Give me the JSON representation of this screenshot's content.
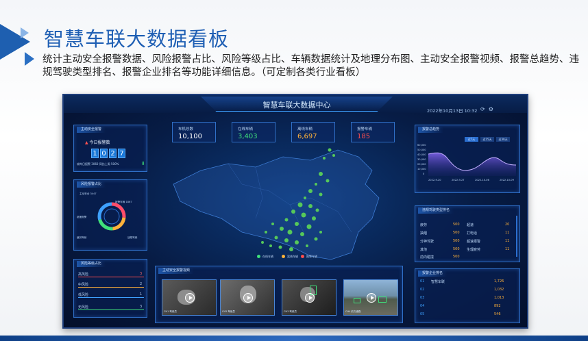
{
  "slide": {
    "title": "智慧车联大数据看板",
    "description": "统计主动安全报警数据、风险报警占比、风险等级占比、车辆数据统计及地理分布图、主动安全报警视频、报警总趋势、违规驾驶类型排名、报警企业排名等功能详细信息。（可定制各类行业看板）"
  },
  "dashboard": {
    "title": "智慧车联大数据中心",
    "datetime": "2022年10月13日 10:32",
    "stats": [
      {
        "label": "车机总数",
        "value": "10,100",
        "color": "#ffffff"
      },
      {
        "label": "在线车辆",
        "value": "3,403",
        "color": "#3fe07a"
      },
      {
        "label": "离线车辆",
        "value": "6,697",
        "color": "#ffb23a"
      },
      {
        "label": "报警车辆",
        "value": "185",
        "color": "#ff4d4d"
      }
    ],
    "left_panels": {
      "alarm_title": "主动安全报警",
      "today_label": "今日报警数",
      "digits": [
        "1",
        "0",
        "2",
        "7"
      ],
      "compare_text": "较昨日报警 3060   同比上周 500%",
      "risk_title": "风险报警占比",
      "risk_labels": [
        "主动安全 3447",
        "报警车辆 1867",
        "超速报警",
        "疲劳驾驶",
        "违规驾驶"
      ],
      "level_title": "风险等级占比",
      "level_rows": [
        {
          "name": "高风险",
          "value": "3"
        },
        {
          "name": "中风险",
          "value": "2"
        },
        {
          "name": "低风险",
          "value": "1"
        },
        {
          "name": "无风险",
          "value": "3"
        }
      ]
    },
    "map": {
      "legend": [
        "在线车辆",
        "离线车辆",
        "报警车辆"
      ],
      "legend_colors": [
        "#3fe07a",
        "#ffb23a",
        "#ff4d4d"
      ]
    },
    "video_section": {
      "title": "主动安全报警视频",
      "cams": [
        "CH1 驾驶员",
        "CH2 驾驶员",
        "CH3 驾驶员",
        "CH4 前方道路"
      ]
    },
    "trend": {
      "title": "报警总趋势",
      "tabs": [
        "近7天",
        "近15天",
        "近30天"
      ],
      "y_ticks": [
        "60,000",
        "50,000",
        "40,000",
        "30,000",
        "20,000",
        "10,000",
        "0"
      ],
      "x_ticks": [
        "2022-9-20",
        "2022-9-27",
        "2022-10-06",
        "2022-10-09"
      ]
    },
    "violation": {
      "title": "违规驾驶类型排名",
      "rows": [
        {
          "a": "疲劳",
          "b": "500",
          "c": "超速",
          "d": "20"
        },
        {
          "a": "抽烟",
          "b": "500",
          "c": "打电话",
          "d": "11"
        },
        {
          "a": "分神驾驶",
          "b": "500",
          "c": "超速报警",
          "d": "11"
        },
        {
          "a": "其他",
          "b": "500",
          "c": "生理疲劳",
          "d": "11"
        },
        {
          "a": "前向碰撞",
          "b": "500",
          "c": "",
          "d": ""
        }
      ]
    },
    "company": {
      "title": "报警企业排名",
      "rows": [
        {
          "rank": "01",
          "name": "智慧车联",
          "value": "1,726"
        },
        {
          "rank": "02",
          "name": "",
          "value": "1,032"
        },
        {
          "rank": "03",
          "name": "",
          "value": "1,013"
        },
        {
          "rank": "04",
          "name": "",
          "value": "892"
        },
        {
          "rank": "05",
          "name": "",
          "value": "546"
        }
      ]
    }
  }
}
